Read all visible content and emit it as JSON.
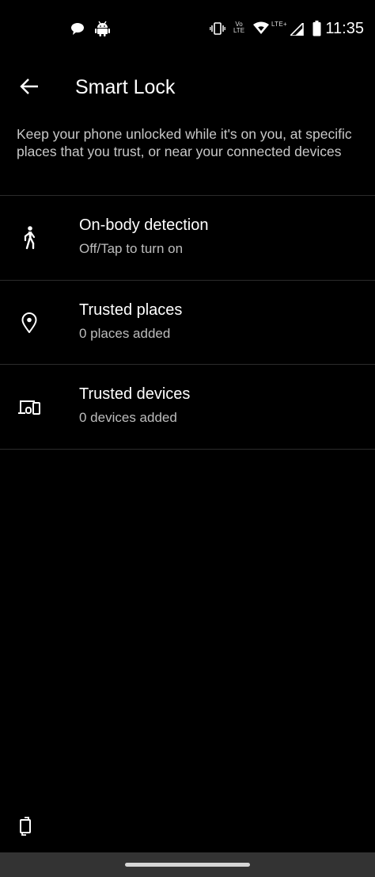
{
  "status_bar": {
    "time": "11:35",
    "volte_line1": "Vo",
    "volte_line2": "LTE",
    "lte_label": "LTE+",
    "left_icons": [
      "chat-bubble-icon",
      "android-icon"
    ],
    "right_icons": [
      "vibrate-icon",
      "volte-icon",
      "wifi-icon",
      "signal-icon",
      "battery-icon"
    ]
  },
  "header": {
    "title": "Smart Lock",
    "back_icon": "arrow-back-icon"
  },
  "description": "Keep your phone unlocked while it's on you, at specific places that you trust, or near your connected devices",
  "items": [
    {
      "icon": "walking-person-icon",
      "title": "On-body detection",
      "subtitle": "Off/Tap to turn on"
    },
    {
      "icon": "location-pin-icon",
      "title": "Trusted places",
      "subtitle": "0 places added"
    },
    {
      "icon": "devices-icon",
      "title": "Trusted devices",
      "subtitle": "0 devices added"
    }
  ],
  "bottom": {
    "rotate_icon": "screen-rotate-icon"
  },
  "colors": {
    "background": "#000000",
    "text_primary": "#ffffff",
    "text_secondary": "#bdbdbd",
    "divider": "#2b2b2b",
    "nav_bar": "#333333"
  }
}
